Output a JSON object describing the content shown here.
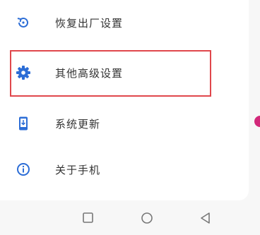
{
  "settings": {
    "items": [
      {
        "label": "恢复出厂设置",
        "icon": "restore-icon"
      },
      {
        "label": "其他高级设置",
        "icon": "gear-icon"
      },
      {
        "label": "系统更新",
        "icon": "phone-update-icon"
      },
      {
        "label": "关于手机",
        "icon": "info-icon"
      }
    ],
    "highlight_color": "#e0474c",
    "badge_color": "#d2287a"
  },
  "navbar": {
    "buttons": [
      "recent-apps",
      "home",
      "back"
    ]
  }
}
